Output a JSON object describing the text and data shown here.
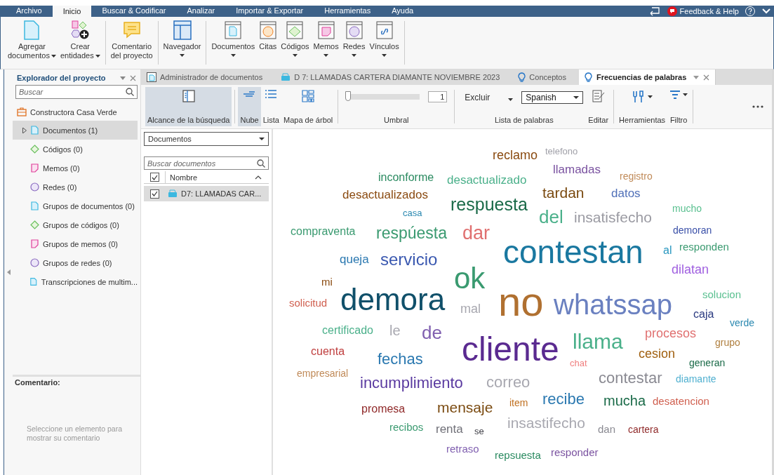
{
  "menu_tabs": [
    {
      "label": "Archivo",
      "selected": false
    },
    {
      "label": "Inicio",
      "selected": true
    },
    {
      "label": "Buscar & Codificar",
      "selected": false
    },
    {
      "label": "Analizar",
      "selected": false
    },
    {
      "label": "Importar & Exportar",
      "selected": false
    },
    {
      "label": "Herramientas",
      "selected": false
    },
    {
      "label": "Ayuda",
      "selected": false
    }
  ],
  "feedback": "Feedback & Help",
  "ribbon": [
    {
      "buttons": [
        {
          "lines": [
            "Agregar",
            "documentos"
          ],
          "has_menu": true
        },
        {
          "lines": [
            "Crear",
            "entidades"
          ],
          "has_menu": true
        }
      ]
    },
    {
      "buttons": [
        {
          "lines": [
            "Comentario",
            "del proyecto"
          ],
          "has_menu": false
        }
      ]
    },
    {
      "buttons": [
        {
          "lines": [
            "Navegador"
          ],
          "has_menu": true
        }
      ]
    },
    {
      "buttons": [
        {
          "lines": [
            "Documentos"
          ],
          "has_menu": true
        },
        {
          "lines": [
            "Citas"
          ],
          "has_menu": false
        },
        {
          "lines": [
            "Códigos"
          ],
          "has_menu": true
        },
        {
          "lines": [
            "Memos"
          ],
          "has_menu": true
        },
        {
          "lines": [
            "Redes"
          ],
          "has_menu": true
        },
        {
          "lines": [
            "Vínculos"
          ],
          "has_menu": true
        }
      ]
    }
  ],
  "explorer": {
    "title": "Explorador del proyecto",
    "search_placeholder": "Buscar",
    "project": "Constructora Casa Verde",
    "items": [
      {
        "label": "Documentos (1)",
        "selected": true,
        "expandable": true
      },
      {
        "label": "Códigos (0)",
        "selected": false,
        "expandable": false
      },
      {
        "label": "Memos (0)",
        "selected": false,
        "expandable": false
      },
      {
        "label": "Redes (0)",
        "selected": false,
        "expandable": false
      },
      {
        "label": "Grupos de documentos (0)",
        "selected": false,
        "expandable": false
      },
      {
        "label": "Grupos de códigos (0)",
        "selected": false,
        "expandable": false
      },
      {
        "label": "Grupos de memos (0)",
        "selected": false,
        "expandable": false
      },
      {
        "label": "Grupos de redes (0)",
        "selected": false,
        "expandable": false
      },
      {
        "label": "Transcripciones de multim...",
        "selected": false,
        "expandable": false
      }
    ]
  },
  "comment": {
    "title": "Comentario:",
    "hint": "Seleccione un elemento para mostrar su comentario"
  },
  "doc_tabs": [
    {
      "label": "Administrador de documentos",
      "selected": false
    },
    {
      "label": "D 7: LLAMADAS CARTERA DIAMANTE NOVIEMBRE 2023",
      "selected": false
    },
    {
      "label": "Conceptos",
      "selected": false
    },
    {
      "label": "Frecuencias de palabras",
      "selected": true
    }
  ],
  "toolbar": {
    "scope": {
      "label": "Alcance de la búsqueda",
      "selected": true
    },
    "views": [
      {
        "label": "Nube",
        "selected": true
      },
      {
        "label": "Lista",
        "selected": false
      },
      {
        "label": "Mapa de árbol",
        "selected": false
      }
    ],
    "threshold": {
      "level": 0,
      "value": "1",
      "label": "Umbral"
    },
    "exclude": "Excluir",
    "language": "Spanish",
    "word_list_label": "Lista de palabras",
    "edit": "Editar",
    "tools": "Herramientas",
    "filter": "Filtro"
  },
  "documents_panel": {
    "scope": "Documentos",
    "search_placeholder": "Buscar documentos",
    "header_checked": true,
    "column": "Nombre",
    "rows": [
      {
        "name": "D7: LLAMADAS CAR...",
        "checked": true,
        "selected": true
      }
    ]
  },
  "words": [
    {
      "text": "reclamo",
      "color": "#8a4a10"
    },
    {
      "text": "telefono",
      "color": "#a0a0a8"
    },
    {
      "text": "llamadas",
      "color": "#7a52a0"
    },
    {
      "text": "inconforme",
      "color": "#2a8a60"
    },
    {
      "text": "desactualizado",
      "color": "#4ab08a"
    },
    {
      "text": "registro",
      "color": "#c08a58"
    },
    {
      "text": "desactualizados",
      "color": "#8a4a10"
    },
    {
      "text": "tardan",
      "color": "#7a4a10"
    },
    {
      "text": "datos",
      "color": "#5070b8"
    },
    {
      "text": "respuesta",
      "color": "#1a6a48"
    },
    {
      "text": "casa",
      "color": "#2a88b0"
    },
    {
      "text": "del",
      "color": "#4ab08a"
    },
    {
      "text": "insatisfecho",
      "color": "#9a9aa2"
    },
    {
      "text": "mucho",
      "color": "#5ac090"
    },
    {
      "text": "compraventa",
      "color": "#3a9a70"
    },
    {
      "text": "respúesta",
      "color": "#3a9a70"
    },
    {
      "text": "dar",
      "color": "#e07070"
    },
    {
      "text": "demoran",
      "color": "#3a50a8"
    },
    {
      "text": "contestan",
      "color": "#1a78a0"
    },
    {
      "text": "al",
      "color": "#2a98c0"
    },
    {
      "text": "responden",
      "color": "#3a9a70"
    },
    {
      "text": "queja",
      "color": "#2a78b0"
    },
    {
      "text": "servicio",
      "color": "#3a58b0"
    },
    {
      "text": "dilatan",
      "color": "#a060e0"
    },
    {
      "text": "mi",
      "color": "#8a4a10"
    },
    {
      "text": "ok",
      "color": "#3a9a70"
    },
    {
      "text": "solicitud",
      "color": "#d06050"
    },
    {
      "text": "demora",
      "color": "#10506a"
    },
    {
      "text": "mal",
      "color": "#a8a8b0"
    },
    {
      "text": "no",
      "color": "#b07030"
    },
    {
      "text": "whatssap",
      "color": "#6a80c0"
    },
    {
      "text": "solucion",
      "color": "#5ac090"
    },
    {
      "text": "caja",
      "color": "#2a3a80"
    },
    {
      "text": "verde",
      "color": "#2a88b0"
    },
    {
      "text": "certificado",
      "color": "#4ab08a"
    },
    {
      "text": "le",
      "color": "#a8a8b0"
    },
    {
      "text": "de",
      "color": "#8060b0"
    },
    {
      "text": "cliente",
      "color": "#5a2a90"
    },
    {
      "text": "llama",
      "color": "#4ab08a"
    },
    {
      "text": "procesos",
      "color": "#e07070"
    },
    {
      "text": "grupo",
      "color": "#b08040"
    },
    {
      "text": "cuenta",
      "color": "#c04040"
    },
    {
      "text": "fechas",
      "color": "#2a78b0"
    },
    {
      "text": "chat",
      "color": "#f08080"
    },
    {
      "text": "cesion",
      "color": "#a06010"
    },
    {
      "text": "generan",
      "color": "#1a6a48"
    },
    {
      "text": "empresarial",
      "color": "#c08a58"
    },
    {
      "text": "incumplimiento",
      "color": "#5a3aa0"
    },
    {
      "text": "correo",
      "color": "#a8a8b0"
    },
    {
      "text": "contestar",
      "color": "#8a8a92"
    },
    {
      "text": "diamante",
      "color": "#50b0d0"
    },
    {
      "text": "promesa",
      "color": "#902a2a"
    },
    {
      "text": "mensaje",
      "color": "#7a4a10"
    },
    {
      "text": "item",
      "color": "#c07020"
    },
    {
      "text": "recibe",
      "color": "#2a78b0"
    },
    {
      "text": "mucha",
      "color": "#1a6a48"
    },
    {
      "text": "desatencion",
      "color": "#d06050"
    },
    {
      "text": "recibos",
      "color": "#3a9a70"
    },
    {
      "text": "renta",
      "color": "#707078"
    },
    {
      "text": "se",
      "color": "#404048"
    },
    {
      "text": "insastifecho",
      "color": "#a8a8b0"
    },
    {
      "text": "dan",
      "color": "#8a8a92"
    },
    {
      "text": "cartera",
      "color": "#902a2a"
    },
    {
      "text": "retraso",
      "color": "#8060b0"
    },
    {
      "text": "repsuesta",
      "color": "#2a8a60"
    },
    {
      "text": "responder",
      "color": "#7a52a0"
    }
  ]
}
